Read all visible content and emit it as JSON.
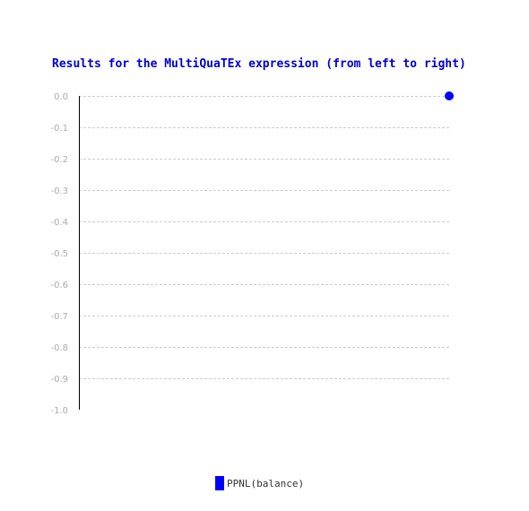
{
  "chart_data": {
    "type": "scatter",
    "title": "Results for the MultiQuaTEx expression (from left to right)",
    "xlabel": "",
    "ylabel": "",
    "ylim": [
      -1.0,
      0.0
    ],
    "yticks": [
      "0.0",
      "-0.1",
      "-0.2",
      "-0.3",
      "-0.4",
      "-0.5",
      "-0.6",
      "-0.7",
      "-0.8",
      "-0.9",
      "-1.0"
    ],
    "grid": true,
    "legend_position": "bottom-center",
    "series": [
      {
        "name": "PPNL(balance)",
        "color": "#0000ff",
        "x": [
          1
        ],
        "y": [
          0.0
        ]
      }
    ]
  },
  "colors": {
    "title": "#0000cc",
    "series": "#0000ff",
    "grid": "#cccccc",
    "tick": "#aaaaaa",
    "axis": "#000000"
  }
}
